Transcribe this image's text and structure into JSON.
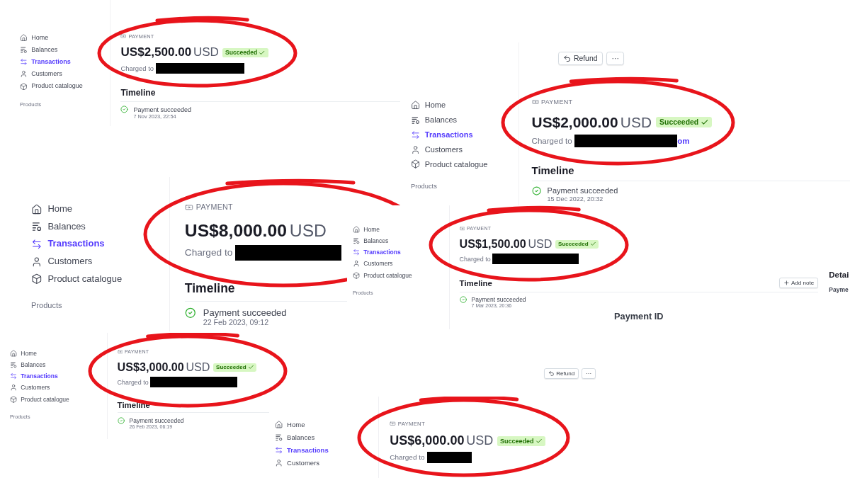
{
  "clips": [
    {
      "nav": [
        {
          "label": "Home",
          "selected": false
        },
        {
          "label": "Balances",
          "selected": false
        },
        {
          "label": "Transactions",
          "selected": true
        },
        {
          "label": "Customers",
          "selected": false
        },
        {
          "label": "Product catalogue",
          "selected": false
        }
      ],
      "section": "Products",
      "payment_label": "PAYMENT",
      "amount": "US$2,500.00",
      "currency": "USD",
      "status": "Succeeded",
      "charged_to": "Charged to",
      "timeline_title": "Timeline",
      "events": [
        {
          "title": "Payment succeeded",
          "date": "7 Nov 2023, 22:54"
        }
      ]
    },
    {
      "nav": [
        {
          "label": "Home",
          "selected": false
        },
        {
          "label": "Balances",
          "selected": false
        },
        {
          "label": "Transactions",
          "selected": true
        },
        {
          "label": "Customers",
          "selected": false
        },
        {
          "label": "Product catalogue",
          "selected": false
        }
      ],
      "section": "Products",
      "toolbar": {
        "refund": "Refund",
        "more": "···"
      },
      "payment_label": "PAYMENT",
      "amount": "US$2,000.00",
      "currency": "USD",
      "status": "Succeeded",
      "charged_to": "Charged to",
      "charged_suffix": "om",
      "timeline_title": "Timeline",
      "events": [
        {
          "title": "Payment succeeded",
          "date": "15 Dec 2022, 20:32"
        }
      ]
    },
    {
      "nav": [
        {
          "label": "Home",
          "selected": false
        },
        {
          "label": "Balances",
          "selected": false
        },
        {
          "label": "Transactions",
          "selected": true
        },
        {
          "label": "Customers",
          "selected": false
        },
        {
          "label": "Product catalogue",
          "selected": false
        }
      ],
      "section": "Products",
      "payment_label": "PAYMENT",
      "amount": "US$8,000.00",
      "currency": "USD",
      "charged_to": "Charged to",
      "timeline_title": "Timeline",
      "events": [
        {
          "title": "Payment succeeded",
          "date": "22 Feb 2023, 09:12"
        }
      ]
    },
    {
      "nav": [
        {
          "label": "Home",
          "selected": false
        },
        {
          "label": "Balances",
          "selected": false
        },
        {
          "label": "Transactions",
          "selected": true
        },
        {
          "label": "Customers",
          "selected": false
        },
        {
          "label": "Product catalogue",
          "selected": false
        }
      ],
      "section": "Products",
      "payment_label": "PAYMENT",
      "amount": "US$1,500.00",
      "currency": "USD",
      "status": "Succeeded",
      "charged_to": "Charged to",
      "timeline_title": "Timeline",
      "add_note": "Add note",
      "events": [
        {
          "title": "Payment succeeded",
          "date": "7 Mar 2023, 20:36"
        }
      ],
      "footer_label": "Payment ID",
      "details_title": "Detai",
      "details_label": "Payme"
    },
    {
      "nav": [
        {
          "label": "Home",
          "selected": false
        },
        {
          "label": "Balances",
          "selected": false
        },
        {
          "label": "Transactions",
          "selected": true
        },
        {
          "label": "Customers",
          "selected": false
        },
        {
          "label": "Product catalogue",
          "selected": false
        }
      ],
      "section": "Products",
      "toolbar": {
        "refund": "Refund",
        "more": "···"
      },
      "payment_label": "PAYMENT",
      "amount": "US$3,000.00",
      "currency": "USD",
      "status": "Succeeded",
      "charged_to": "Charged to",
      "timeline_title": "Timeline",
      "events": [
        {
          "title": "Payment succeeded",
          "date": "26 Feb 2023, 06:19"
        }
      ]
    },
    {
      "nav": [
        {
          "label": "Home",
          "selected": false
        },
        {
          "label": "Balances",
          "selected": false
        },
        {
          "label": "Transactions",
          "selected": true
        },
        {
          "label": "Customers",
          "selected": false
        }
      ],
      "payment_label": "PAYMENT",
      "amount": "US$6,000.00",
      "currency": "USD",
      "status": "Succeeded",
      "charged_to": "Charged to"
    }
  ]
}
